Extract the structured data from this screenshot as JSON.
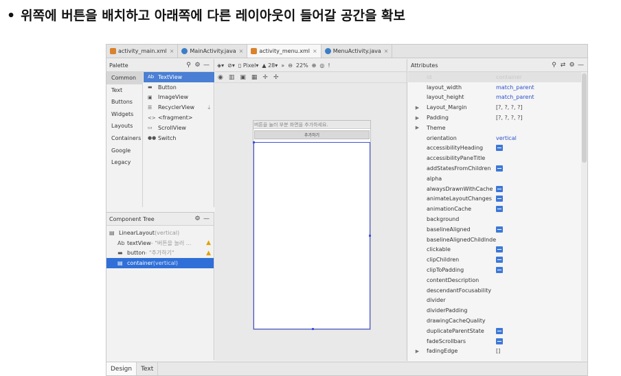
{
  "slide": {
    "bullet": "•",
    "heading": "위쪽에 버튼을 배치하고 아래쪽에 다른 레이아웃이 들어갈 공간을 확보"
  },
  "tabs": [
    {
      "label": "activity_main.xml",
      "type": "xml",
      "active": false
    },
    {
      "label": "MainActivity.java",
      "type": "java",
      "active": false
    },
    {
      "label": "activity_menu.xml",
      "type": "xml",
      "active": true
    },
    {
      "label": "MenuActivity.java",
      "type": "java",
      "active": false
    }
  ],
  "palette": {
    "title": "Palette",
    "categories": [
      "Common",
      "Text",
      "Buttons",
      "Widgets",
      "Layouts",
      "Containers",
      "Google",
      "Legacy"
    ],
    "items": [
      {
        "icon": "Ab",
        "label": "TextView"
      },
      {
        "icon": "▬",
        "label": "Button"
      },
      {
        "icon": "▣",
        "label": "ImageView"
      },
      {
        "icon": "☰",
        "label": "RecyclerView"
      },
      {
        "icon": "<>",
        "label": "<fragment>"
      },
      {
        "icon": "▭",
        "label": "ScrollView"
      },
      {
        "icon": "●●",
        "label": "Switch"
      }
    ]
  },
  "component_tree": {
    "title": "Component Tree",
    "rows": [
      {
        "icon": "▤",
        "name": "LinearLayout",
        "sub": "(vertical)",
        "indent": 0,
        "warn": false,
        "selected": false
      },
      {
        "icon": "Ab",
        "name": "textView",
        "sub": "- \"버튼을 눌러 ...",
        "indent": 1,
        "warn": true,
        "selected": false
      },
      {
        "icon": "▬",
        "name": "button",
        "sub": "- \"추가하기\"",
        "indent": 1,
        "warn": true,
        "selected": false
      },
      {
        "icon": "▤",
        "name": "container",
        "sub": "(vertical)",
        "indent": 1,
        "warn": false,
        "selected": true
      }
    ]
  },
  "design_toolbar": {
    "device": "Pixel",
    "api": "28",
    "zoom": "22%"
  },
  "preview": {
    "text": "버튼을 눌러 부분 화면을 추가하세요.",
    "button": "추가하기"
  },
  "attributes": {
    "title": "Attributes",
    "rows": [
      {
        "name": "id",
        "value": "container",
        "kind": "id",
        "expand": false
      },
      {
        "name": "layout_width",
        "value": "match_parent",
        "kind": "link",
        "expand": false
      },
      {
        "name": "layout_height",
        "value": "match_parent",
        "kind": "link",
        "expand": false
      },
      {
        "name": "Layout_Margin",
        "value": "[?, ?, ?, ?]",
        "kind": "plain",
        "expand": true
      },
      {
        "name": "Padding",
        "value": "[?, ?, ?, ?]",
        "kind": "plain",
        "expand": true
      },
      {
        "name": "Theme",
        "value": "",
        "kind": "plain",
        "expand": true
      },
      {
        "name": "orientation",
        "value": "vertical",
        "kind": "link",
        "expand": false
      },
      {
        "name": "accessibilityHeading",
        "value": "",
        "kind": "flag",
        "expand": false
      },
      {
        "name": "accessibilityPaneTitle",
        "value": "",
        "kind": "plain",
        "expand": false
      },
      {
        "name": "addStatesFromChildren",
        "value": "",
        "kind": "flag",
        "expand": false
      },
      {
        "name": "alpha",
        "value": "",
        "kind": "plain",
        "expand": false
      },
      {
        "name": "alwaysDrawnWithCache",
        "value": "",
        "kind": "flag",
        "expand": false
      },
      {
        "name": "animateLayoutChanges",
        "value": "",
        "kind": "flag",
        "expand": false
      },
      {
        "name": "animationCache",
        "value": "",
        "kind": "flag",
        "expand": false
      },
      {
        "name": "background",
        "value": "",
        "kind": "plain",
        "expand": false
      },
      {
        "name": "baselineAligned",
        "value": "",
        "kind": "flag",
        "expand": false
      },
      {
        "name": "baselineAlignedChildIndex",
        "value": "",
        "kind": "plain",
        "expand": false
      },
      {
        "name": "clickable",
        "value": "",
        "kind": "flag",
        "expand": false
      },
      {
        "name": "clipChildren",
        "value": "",
        "kind": "flag",
        "expand": false
      },
      {
        "name": "clipToPadding",
        "value": "",
        "kind": "flag",
        "expand": false
      },
      {
        "name": "contentDescription",
        "value": "",
        "kind": "plain",
        "expand": false
      },
      {
        "name": "descendantFocusability",
        "value": "",
        "kind": "plain",
        "expand": false
      },
      {
        "name": "divider",
        "value": "",
        "kind": "plain",
        "expand": false
      },
      {
        "name": "dividerPadding",
        "value": "",
        "kind": "plain",
        "expand": false
      },
      {
        "name": "drawingCacheQuality",
        "value": "",
        "kind": "plain",
        "expand": false
      },
      {
        "name": "duplicateParentState",
        "value": "",
        "kind": "flag",
        "expand": false
      },
      {
        "name": "fadeScrollbars",
        "value": "",
        "kind": "flag",
        "expand": false
      },
      {
        "name": "fadingEdge",
        "value": "[]",
        "kind": "plain",
        "expand": true
      }
    ]
  },
  "bottom_tabs": [
    {
      "label": "Design",
      "active": true
    },
    {
      "label": "Text",
      "active": false
    }
  ],
  "colors": {
    "selection": "#2f6fd7",
    "link_value": "#2b4fcf",
    "container_outline": "#3f51d8",
    "warning": "#e3a008"
  }
}
